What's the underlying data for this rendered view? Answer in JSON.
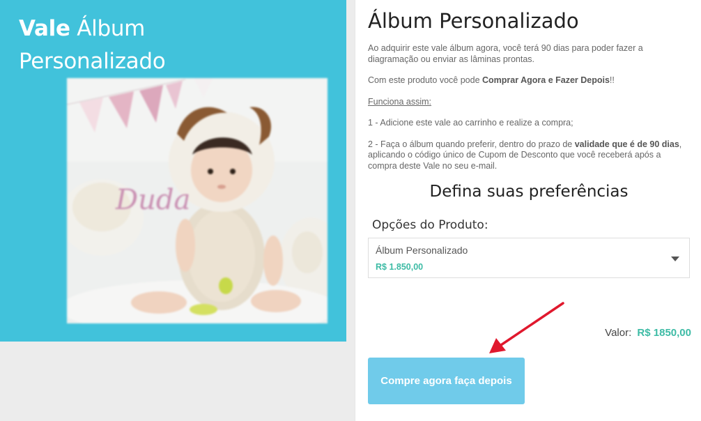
{
  "hero": {
    "title_bold": "Vale",
    "title_rest": "Álbum",
    "title_line2": "Personalizado",
    "cover_name": "Duda",
    "background_color": "#41c2db"
  },
  "product": {
    "title": "Álbum Personalizado",
    "paragraph1": "Ao adquirir este vale álbum agora, você terá 90 dias para poder fazer a diagramação ou enviar as lâminas prontas.",
    "paragraph2_prefix": "Com este produto você pode ",
    "paragraph2_bold": "Comprar Agora e Fazer Depois",
    "paragraph2_suffix": "!!",
    "how_it_works": "Funciona assim:",
    "step1": "1 - Adicione este vale ao carrinho e realize a compra;",
    "step2_prefix": "2 - Faça o álbum quando preferir, dentro do prazo de ",
    "step2_bold": "validade que é de 90 dias",
    "step2_suffix": ", aplicando o código único de Cupom de Desconto que você receberá após a compra deste Vale no seu e-mail."
  },
  "preferences": {
    "title": "Defina suas preferências",
    "options_label": "Opções do Produto:",
    "selected_option": "Álbum Personalizado",
    "selected_price": "R$ 1.850,00"
  },
  "total": {
    "label": "Valor:",
    "amount": "R$ 1850,00"
  },
  "buy_button": {
    "label": "Compre agora faça depois"
  },
  "colors": {
    "accent_price": "#3dbba5",
    "button": "#70cbea",
    "annotation_arrow": "#e0182d"
  },
  "icons": [
    "chevron-down-icon",
    "annotation-arrow-icon"
  ]
}
